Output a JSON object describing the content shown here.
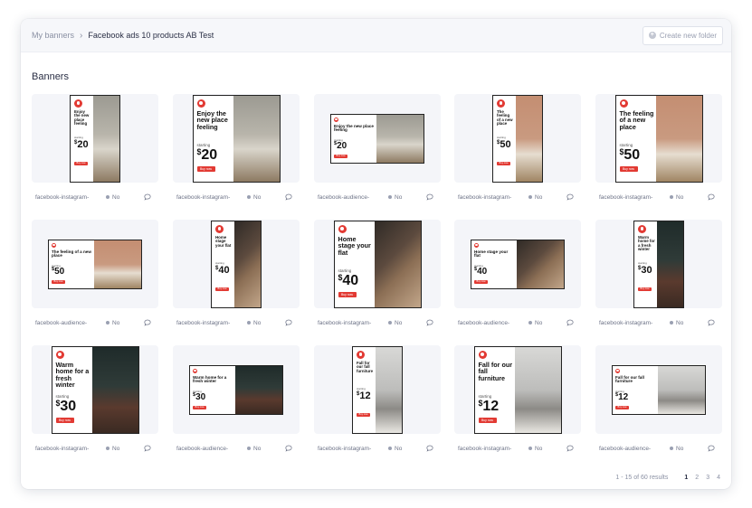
{
  "breadcrumb": {
    "parent": "My banners",
    "current": "Facebook ads 10 products AB Test"
  },
  "header": {
    "new_folder_label": "Create new folder"
  },
  "section": {
    "title": "Banners"
  },
  "colors": {
    "accent": "#e23a33",
    "surface": "#f4f5f9"
  },
  "banners": [
    {
      "name": "facebook-instagram-",
      "status": "No",
      "headline": "Enjoy the new place feeling",
      "starting": "starting",
      "price": "20",
      "cta": "Buy now",
      "format": "story",
      "photo": "sofa"
    },
    {
      "name": "facebook-instagram-",
      "status": "No",
      "headline": "Enjoy the new place feeling",
      "starting": "starting",
      "price": "20",
      "cta": "Buy now",
      "format": "square",
      "photo": "sofa"
    },
    {
      "name": "facebook-audience-",
      "status": "No",
      "headline": "Enjoy the new place feeling",
      "starting": "starting",
      "price": "20",
      "cta": "Buy now",
      "format": "landscape",
      "photo": "sofa"
    },
    {
      "name": "facebook-instagram-",
      "status": "No",
      "headline": "The feeling of a new place",
      "starting": "starting",
      "price": "50",
      "cta": "Buy now",
      "format": "story",
      "photo": "terracotta"
    },
    {
      "name": "facebook-instagram-",
      "status": "No",
      "headline": "The feeling of a new place",
      "starting": "starting",
      "price": "50",
      "cta": "Buy now",
      "format": "square",
      "photo": "terracotta"
    },
    {
      "name": "facebook-audience-",
      "status": "No",
      "headline": "The feeling of a new place",
      "starting": "starting",
      "price": "50",
      "cta": "Buy now",
      "format": "landscape",
      "photo": "terracotta"
    },
    {
      "name": "facebook-instagram-",
      "status": "No",
      "headline": "Home stage your flat",
      "starting": "starting",
      "price": "40",
      "cta": "Buy now",
      "format": "story",
      "photo": "stairs"
    },
    {
      "name": "facebook-instagram-",
      "status": "No",
      "headline": "Home stage your flat",
      "starting": "starting",
      "price": "40",
      "cta": "Buy now",
      "format": "square",
      "photo": "stairs"
    },
    {
      "name": "facebook-audience-",
      "status": "No",
      "headline": "Home stage your flat",
      "starting": "starting",
      "price": "40",
      "cta": "Buy now",
      "format": "landscape",
      "photo": "stairs"
    },
    {
      "name": "facebook-instagram-",
      "status": "No",
      "headline": "Warm home for a fresh winter",
      "starting": "starting",
      "price": "30",
      "cta": "Buy now",
      "format": "story",
      "photo": "dark"
    },
    {
      "name": "facebook-instagram-",
      "status": "No",
      "headline": "Warm home for a fresh winter",
      "starting": "starting",
      "price": "30",
      "cta": "Buy now",
      "format": "square",
      "photo": "dark"
    },
    {
      "name": "facebook-audience-",
      "status": "No",
      "headline": "Warm home for a fresh winter",
      "starting": "starting",
      "price": "30",
      "cta": "Buy now",
      "format": "landscape",
      "photo": "dark"
    },
    {
      "name": "facebook-instagram-",
      "status": "No",
      "headline": "Fall for our fall furniture",
      "starting": "starting",
      "price": "12",
      "cta": "Buy now",
      "format": "story",
      "photo": "grey"
    },
    {
      "name": "facebook-instagram-",
      "status": "No",
      "headline": "Fall for our fall furniture",
      "starting": "starting",
      "price": "12",
      "cta": "Buy now",
      "format": "square",
      "photo": "grey"
    },
    {
      "name": "facebook-audience-",
      "status": "No",
      "headline": "Fall for our fall furniture",
      "starting": "starting",
      "price": "12",
      "cta": "Buy now",
      "format": "landscape",
      "photo": "grey"
    }
  ],
  "pagination": {
    "summary": "1 - 15 of 60 results",
    "pages": [
      "1",
      "2",
      "3",
      "4"
    ],
    "current": "1"
  }
}
